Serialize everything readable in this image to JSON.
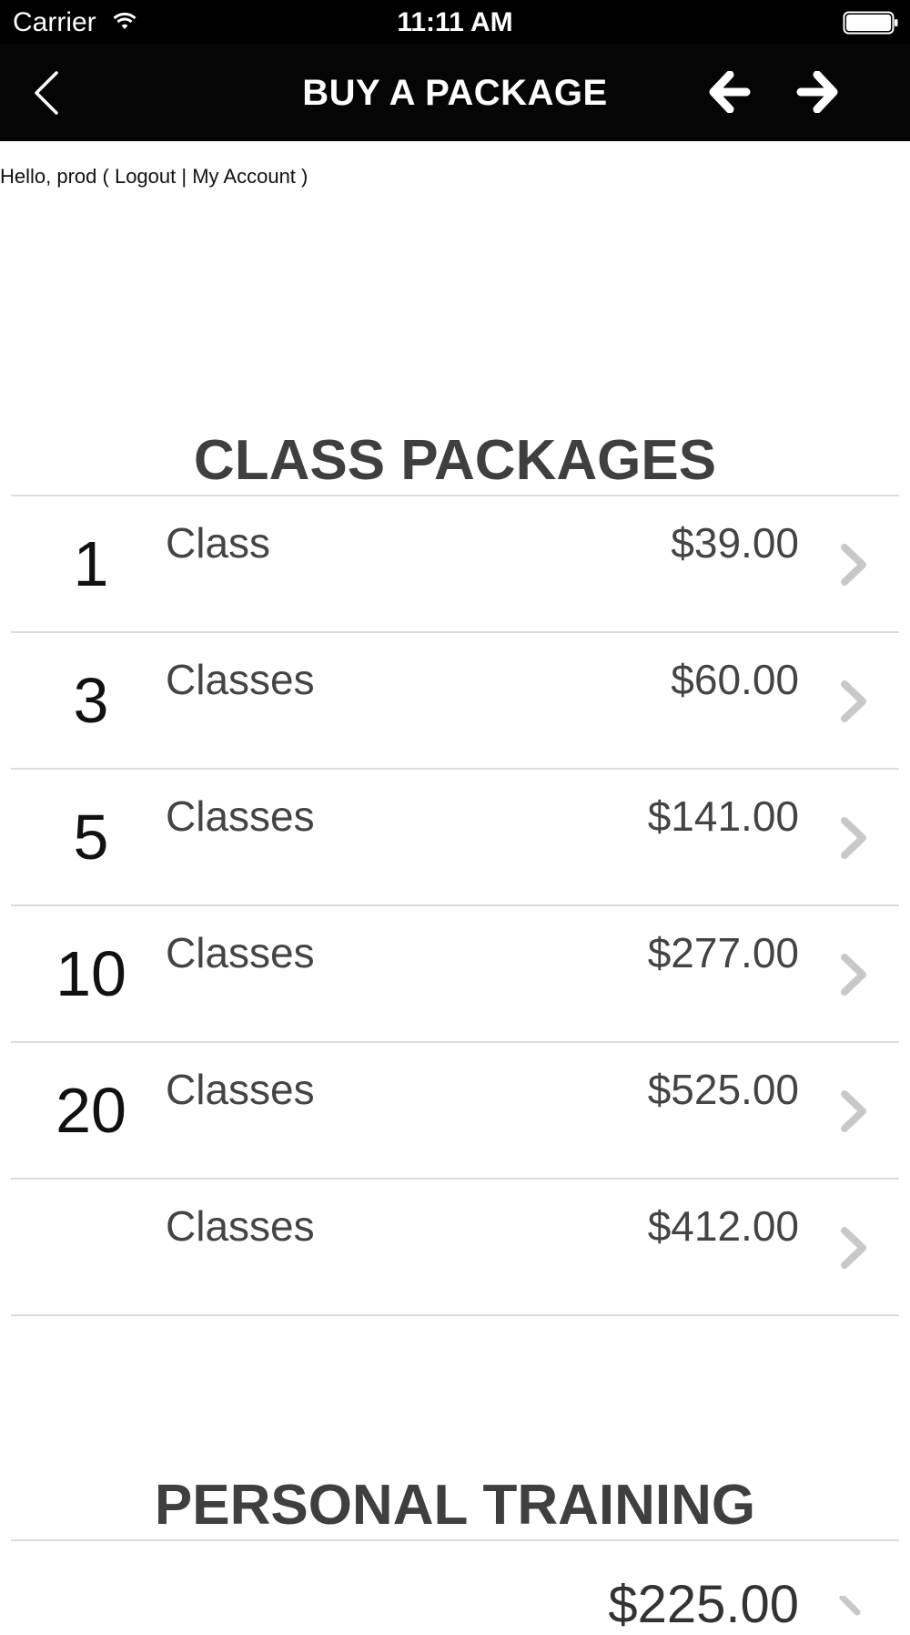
{
  "status_bar": {
    "carrier": "Carrier",
    "time": "11:11 AM"
  },
  "nav": {
    "title": "BUY A PACKAGE"
  },
  "greeting": {
    "prefix": "Hello, prod ( ",
    "logout": "Logout",
    "separator": " | ",
    "account": "My Account",
    "suffix": " )"
  },
  "class_packages": {
    "title": "CLASS PACKAGES",
    "items": [
      {
        "count": "1",
        "unit": "Class",
        "price": "$39.00"
      },
      {
        "count": "3",
        "unit": "Classes",
        "price": "$60.00"
      },
      {
        "count": "5",
        "unit": "Classes",
        "price": "$141.00"
      },
      {
        "count": "10",
        "unit": "Classes",
        "price": "$277.00"
      },
      {
        "count": "20",
        "unit": "Classes",
        "price": "$525.00"
      },
      {
        "count": "",
        "unit": "Classes",
        "price": "$412.00"
      }
    ]
  },
  "personal_training": {
    "title": "PERSONAL TRAINING",
    "partial_price": "$225.00"
  },
  "colors": {
    "nav_background": "#050505",
    "chevron": "#c8c8c8",
    "title_text": "#3f3f3f"
  }
}
